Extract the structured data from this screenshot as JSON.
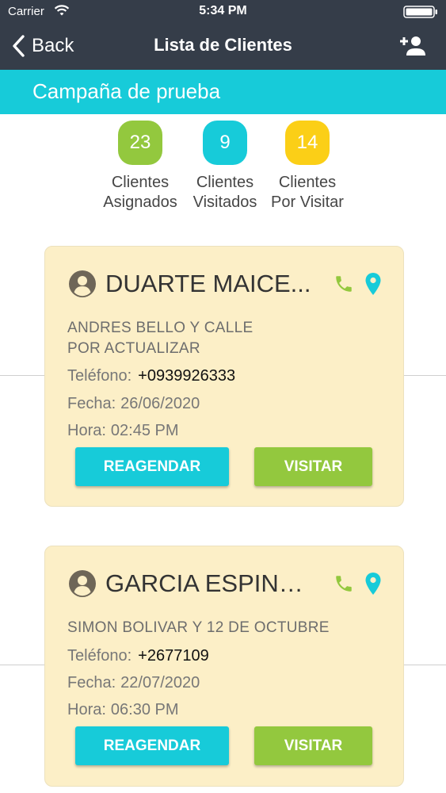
{
  "status_bar": {
    "carrier": "Carrier",
    "time": "5:34 PM"
  },
  "nav": {
    "back_label": "Back",
    "title": "Lista de Clientes",
    "add_icon": "add-user-icon"
  },
  "campaign": {
    "title": "Campaña de prueba"
  },
  "stats": [
    {
      "count": "23",
      "line1": "Clientes",
      "line2": "Asignados",
      "color": "#93c83e"
    },
    {
      "count": "9",
      "line1": "Clientes",
      "line2": "Visitados",
      "color": "#17cbd9"
    },
    {
      "count": "14",
      "line1": "Clientes",
      "line2": "Por Visitar",
      "color": "#fbcf17"
    }
  ],
  "labels": {
    "phone": "Teléfono:",
    "date": "Fecha:",
    "time": "Hora:",
    "reschedule": "REAGENDAR",
    "visit": "VISITAR"
  },
  "clients": [
    {
      "name": "DUARTE MAICE...",
      "address_line1": "ANDRES BELLO Y CALLE",
      "address_line2": "POR ACTUALIZAR",
      "phone": "+0939926333",
      "date": "26/06/2020",
      "time": "02:45 PM"
    },
    {
      "name": "GARCIA ESPINO...",
      "address_line1": "SIMON BOLIVAR Y 12 DE OCTUBRE",
      "phone": "+2677109",
      "date": "22/07/2020",
      "time": "06:30 PM"
    }
  ],
  "colors": {
    "header": "#353d49",
    "accent": "#17cbd9",
    "green": "#93c83e",
    "yellow": "#fbcf17",
    "card": "#fcefc7"
  }
}
